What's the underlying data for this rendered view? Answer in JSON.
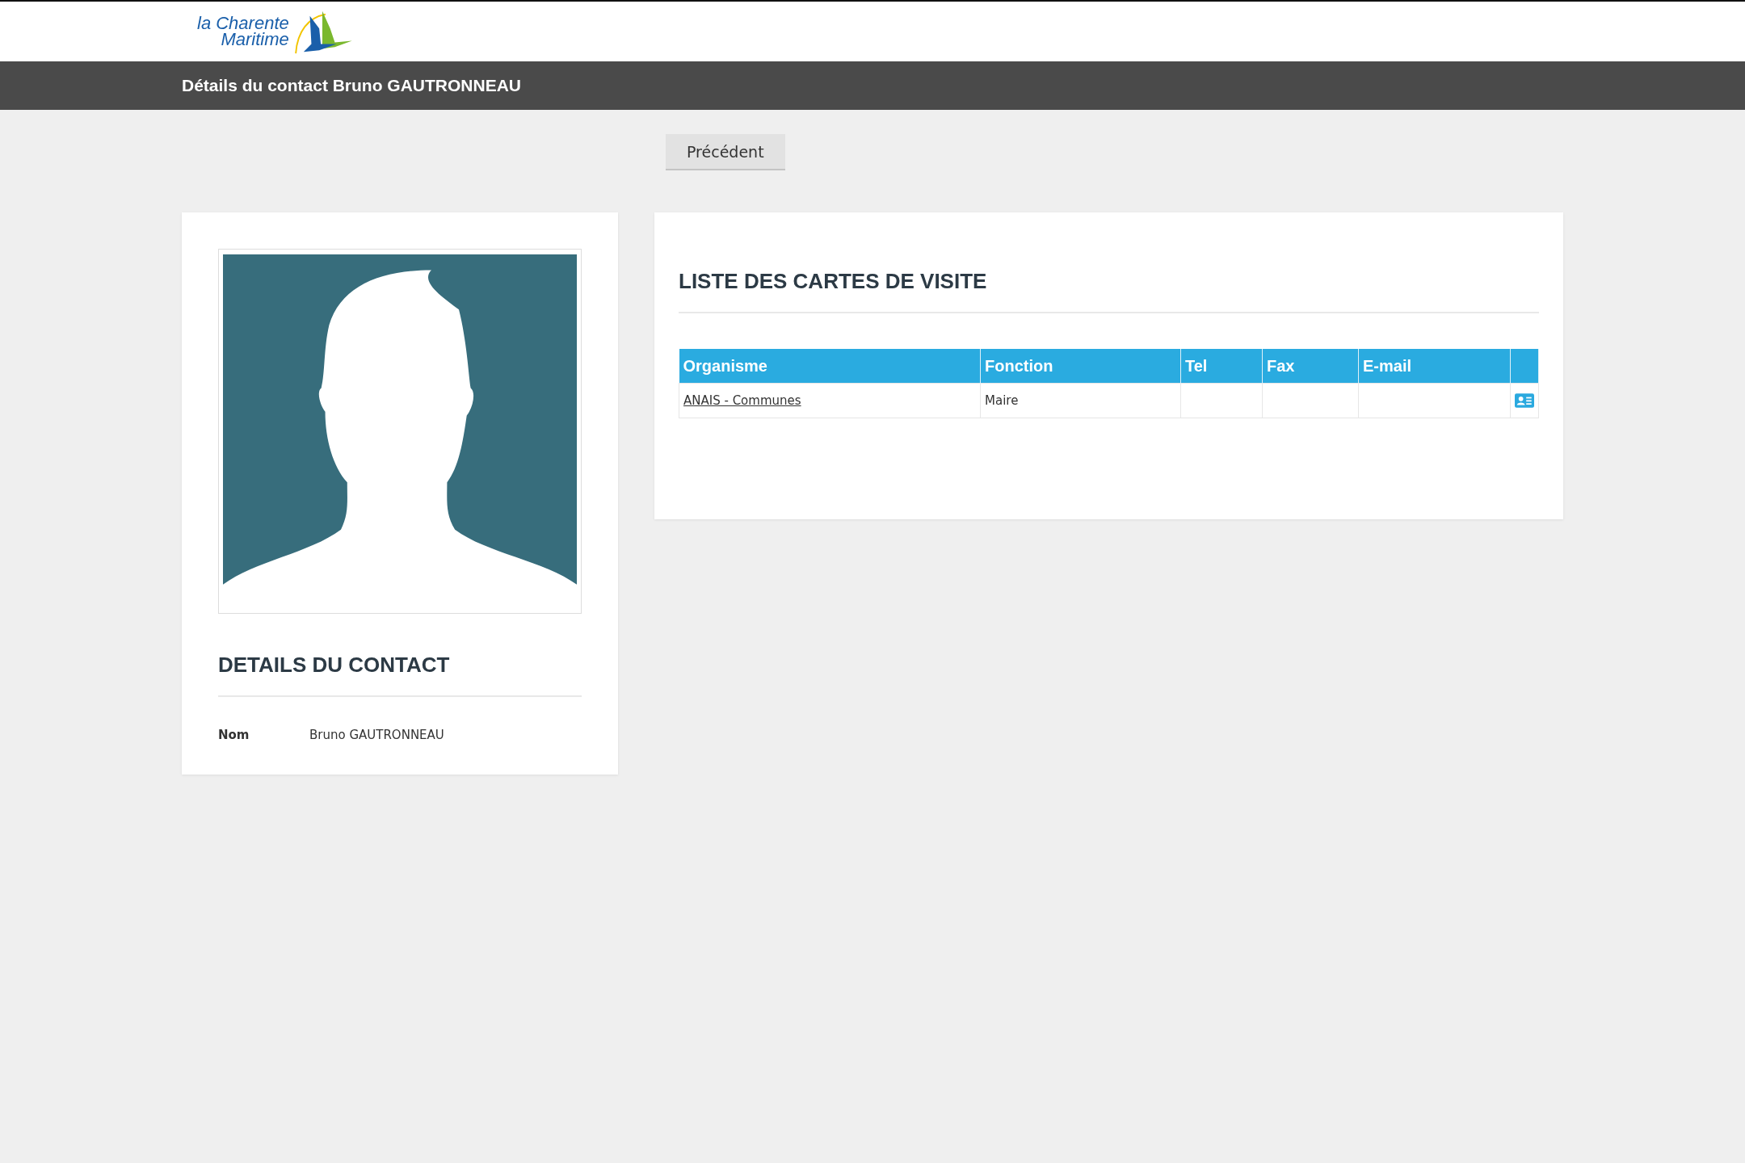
{
  "logo": {
    "lines": [
      "la Charente",
      "Maritime"
    ]
  },
  "page_title": "Détails du contact Bruno GAUTRONNEAU",
  "back_button": "Précédent",
  "contact_card": {
    "avatar": {
      "kind": "silhouette"
    },
    "heading": "DETAILS DU CONTACT",
    "fields": [
      {
        "label": "Nom",
        "value": "Bruno GAUTRONNEAU"
      }
    ]
  },
  "cards_panel": {
    "heading": "LISTE DES CARTES DE VISITE",
    "table": {
      "columns": [
        "Organisme",
        "Fonction",
        "Tel",
        "Fax",
        "E-mail"
      ],
      "rows": [
        {
          "cells": [
            {
              "kind": "link",
              "text": "ANAIS - Communes"
            },
            {
              "kind": "text",
              "text": "Maire"
            }
          ],
          "has_card_icon": true
        }
      ]
    }
  }
}
